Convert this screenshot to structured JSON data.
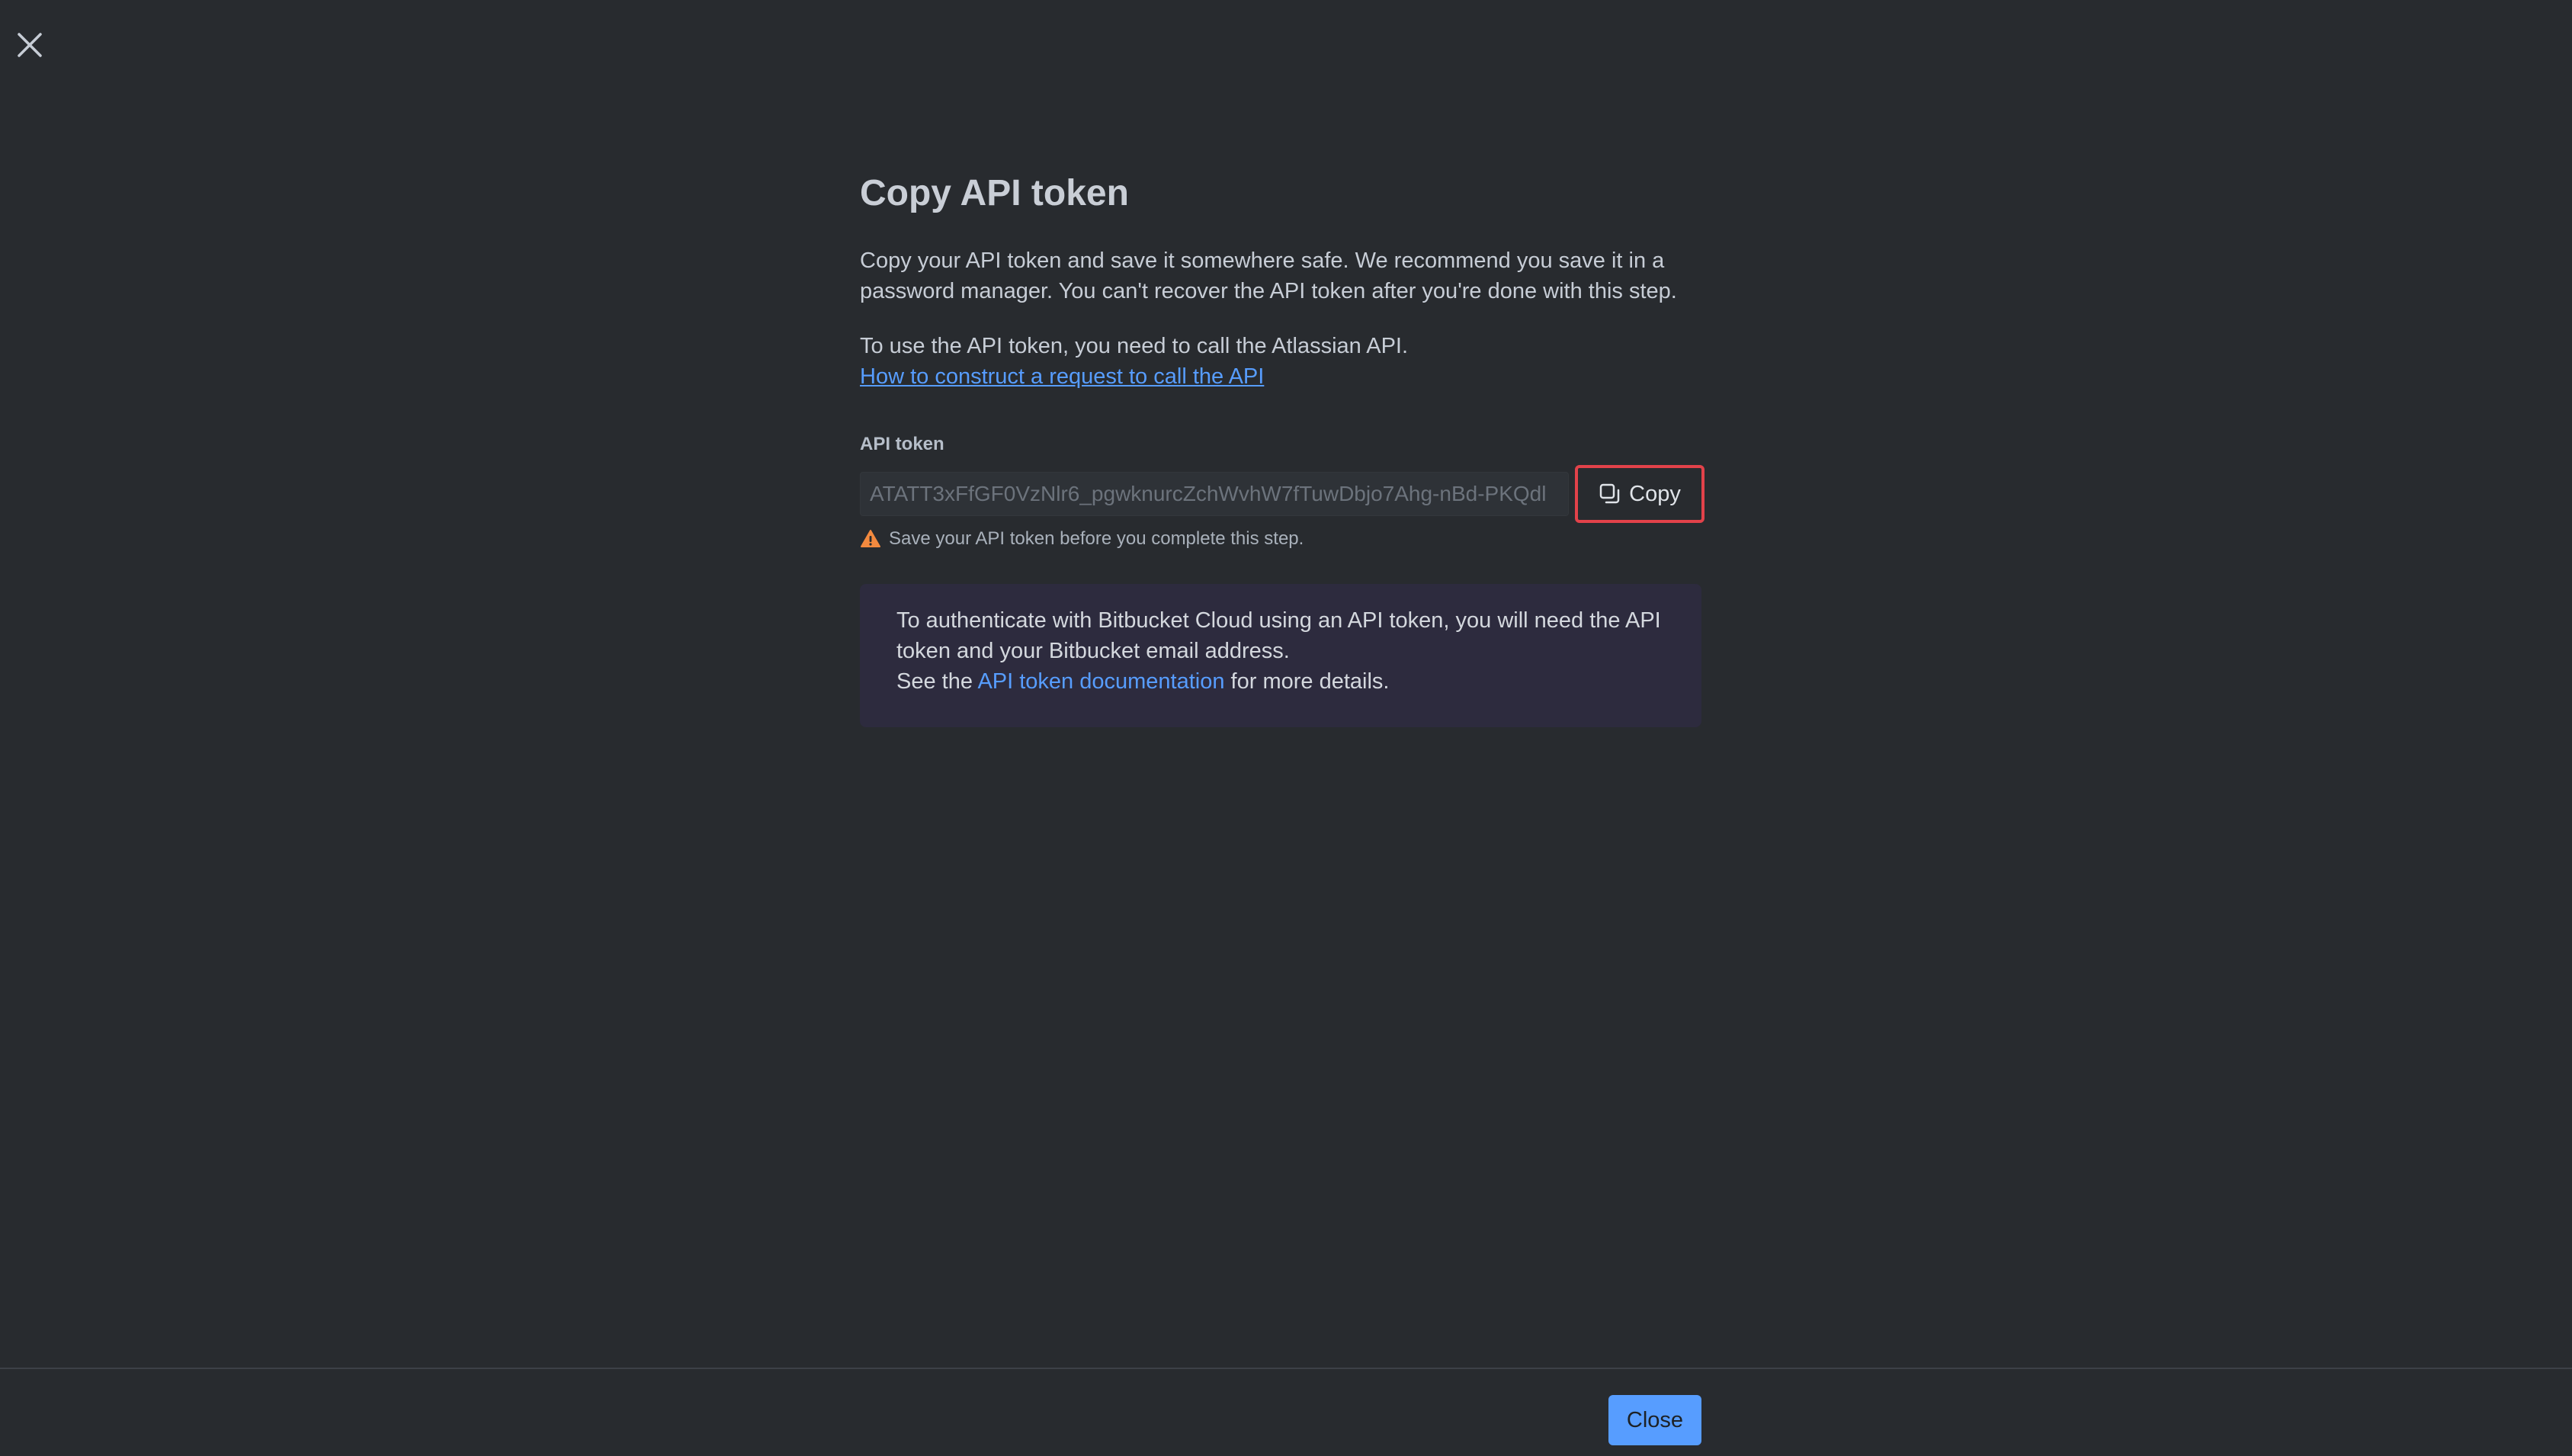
{
  "dialog": {
    "title": "Copy API token",
    "description": "Copy your API token and save it somewhere safe. We recommend you save it in a password manager. You can't recover the API token after you're done with this step.",
    "usage_text": "To use the API token, you need to call the Atlassian API.",
    "usage_link": "How to construct a request to call the API"
  },
  "token_field": {
    "label": "API token",
    "value": "ATATT3xFfGF0VzNlr6_pgwknurcZchWvhW7fTuwDbjo7Ahg-nBd-PKQdl",
    "copy_label": "Copy",
    "warning": "Save your API token before you complete this step."
  },
  "info": {
    "text": "To authenticate with Bitbucket Cloud using an API token, you will need the API token and your Bitbucket email address.",
    "see_prefix": "See the ",
    "link": "API token documentation",
    "see_suffix": " for more details."
  },
  "footer": {
    "close_label": "Close"
  },
  "colors": {
    "background": "#282b2f",
    "link": "#579dff",
    "highlight_border": "#e2424a",
    "warning_icon": "#f38a3f",
    "info_box": "#2d2b3e"
  },
  "icons": {
    "dismiss": "close-icon",
    "copy": "copy-icon",
    "warning": "warning-icon"
  }
}
